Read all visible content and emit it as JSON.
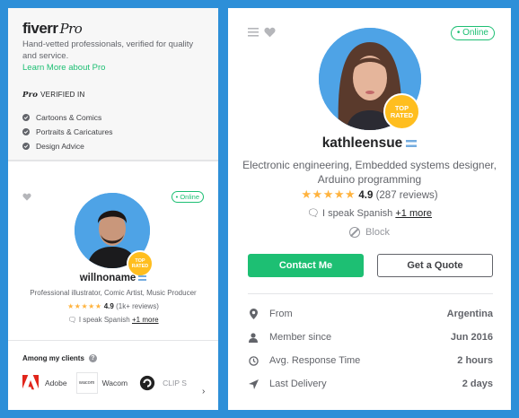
{
  "left": {
    "pro": {
      "logo_brand": "fiverr",
      "logo_pro": "Pro",
      "description": "Hand-vetted professionals, verified for quality and service.",
      "link": "Learn More about Pro",
      "verified_badge": "Pro",
      "verified_title": "VERIFIED IN",
      "verified_items": [
        "Cartoons & Comics",
        "Portraits & Caricatures",
        "Design Advice"
      ]
    },
    "seller": {
      "online": "• Online",
      "badge": "TOP RATED",
      "username": "willnoname",
      "description": "Professional illustrator, Comic Artist, Music Producer",
      "stars": "★★★★★",
      "rating": "4.9",
      "reviews": "(1k+ reviews)",
      "language": "I speak Spanish",
      "language_more": "+1 more"
    },
    "clients": {
      "title": "Among my clients",
      "items": [
        {
          "name": "Adobe",
          "icon": "adobe-logo"
        },
        {
          "name": "Wacom",
          "icon": "wacom-logo",
          "logo_text": "wacom"
        },
        {
          "name": "CLIP S",
          "icon": "clip-studio-logo"
        }
      ]
    }
  },
  "right": {
    "online": "• Online",
    "badge": "TOP RATED",
    "username": "kathleensue",
    "description": "Electronic engineering, Embedded systems designer, Arduino programming",
    "stars": "★★★★★",
    "rating": "4.9",
    "reviews": "(287 reviews)",
    "language": "I speak Spanish",
    "language_more": "+1 more",
    "block": "Block",
    "contact_button": "Contact Me",
    "quote_button": "Get a Quote",
    "stats": [
      {
        "label": "From",
        "value": "Argentina",
        "icon": "location-pin-icon"
      },
      {
        "label": "Member since",
        "value": "Jun 2016",
        "icon": "user-icon"
      },
      {
        "label": "Avg. Response Time",
        "value": "2 hours",
        "icon": "clock-icon"
      },
      {
        "label": "Last Delivery",
        "value": "2 days",
        "icon": "send-icon"
      }
    ]
  },
  "colors": {
    "background": "#2d8fd8",
    "accent": "#1dbf73",
    "star": "#ffb33e",
    "top_rated_badge": "#ffbe1f"
  }
}
